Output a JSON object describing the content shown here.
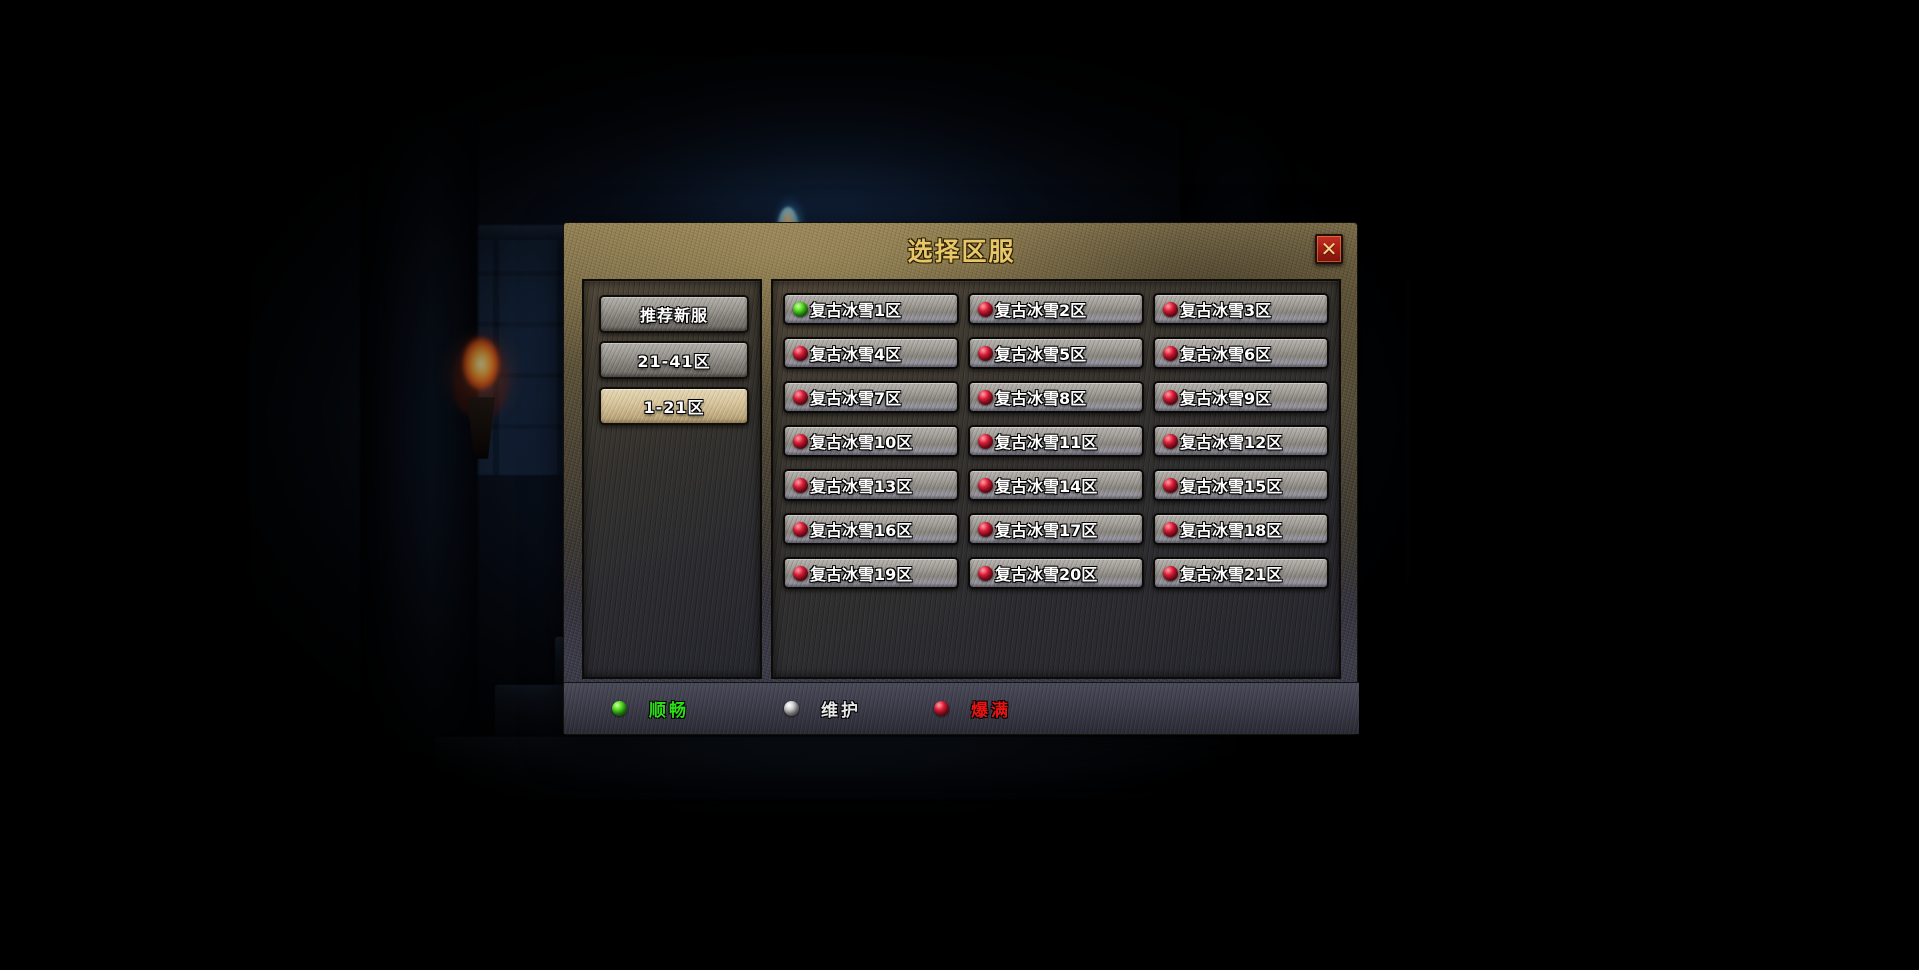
{
  "dialog": {
    "title": "选择区服",
    "close_label": "✕",
    "close_icon": "close-icon"
  },
  "sidebar": {
    "tabs": [
      {
        "label": "推荐新服",
        "active": false
      },
      {
        "label": "21-41区",
        "active": false
      },
      {
        "label": "1-21区",
        "active": true
      }
    ]
  },
  "servers": [
    {
      "name": "复古冰雪1区",
      "status": "green"
    },
    {
      "name": "复古冰雪2区",
      "status": "red"
    },
    {
      "name": "复古冰雪3区",
      "status": "red"
    },
    {
      "name": "复古冰雪4区",
      "status": "red"
    },
    {
      "name": "复古冰雪5区",
      "status": "red"
    },
    {
      "name": "复古冰雪6区",
      "status": "red"
    },
    {
      "name": "复古冰雪7区",
      "status": "red"
    },
    {
      "name": "复古冰雪8区",
      "status": "red"
    },
    {
      "name": "复古冰雪9区",
      "status": "red"
    },
    {
      "name": "复古冰雪10区",
      "status": "red"
    },
    {
      "name": "复古冰雪11区",
      "status": "red"
    },
    {
      "name": "复古冰雪12区",
      "status": "red"
    },
    {
      "name": "复古冰雪13区",
      "status": "red"
    },
    {
      "name": "复古冰雪14区",
      "status": "red"
    },
    {
      "name": "复古冰雪15区",
      "status": "red"
    },
    {
      "name": "复古冰雪16区",
      "status": "red"
    },
    {
      "name": "复古冰雪17区",
      "status": "red"
    },
    {
      "name": "复古冰雪18区",
      "status": "red"
    },
    {
      "name": "复古冰雪19区",
      "status": "red"
    },
    {
      "name": "复古冰雪20区",
      "status": "red"
    },
    {
      "name": "复古冰雪21区",
      "status": "red"
    }
  ],
  "legend": [
    {
      "label": "顺畅",
      "status": "green",
      "color": "#2de016"
    },
    {
      "label": "维护",
      "status": "silver",
      "color": "#e8e8e8"
    },
    {
      "label": "爆满",
      "status": "red",
      "color": "#e81414"
    }
  ],
  "colors": {
    "title_gold": "#e8c76a",
    "close_red": "#a81f16",
    "status_green": "#2de016",
    "status_red": "#e0203a",
    "status_silver": "#d4d4d4"
  }
}
